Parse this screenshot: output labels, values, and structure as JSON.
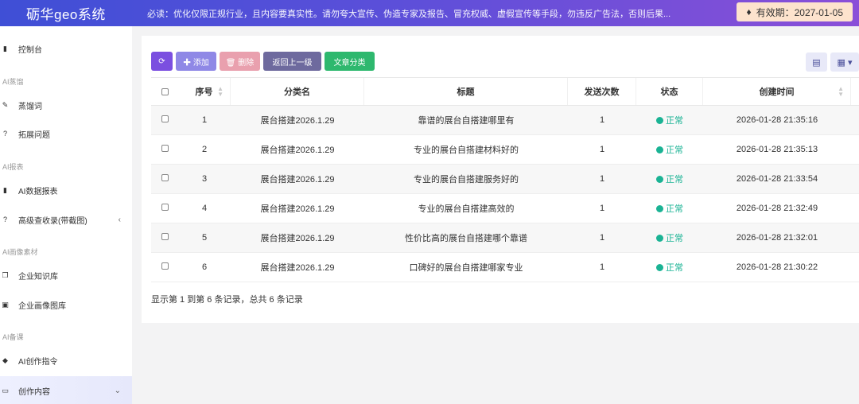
{
  "header": {
    "brand": "砺华geo系统",
    "notice": "必读：优化仅限正规行业，且内容要真实性。请勿夸大宣传、伪造专家及报告、冒充权威、虚假宣传等手段，勿违反广告法，否则后果...",
    "expiry": "有效期：2027-01-05"
  },
  "sidebar": {
    "items": [
      {
        "icon": "bar-chart-icon",
        "glyph": "▮",
        "label": "控制台"
      },
      {
        "group": "AI蒸馏"
      },
      {
        "icon": "pencil-icon",
        "glyph": "✎",
        "label": "蒸馏词"
      },
      {
        "icon": "question-circle-icon",
        "glyph": "?",
        "label": "拓展问题"
      },
      {
        "group": "AI报表"
      },
      {
        "icon": "bar-chart-icon",
        "glyph": "▮",
        "label": "AI数据报表"
      },
      {
        "icon": "question-circle-icon",
        "glyph": "?",
        "label": "高级查收录(带截图)"
      },
      {
        "group": "AI画像素材"
      },
      {
        "icon": "copy-icon",
        "glyph": "❐",
        "label": "企业知识库"
      },
      {
        "icon": "image-icon",
        "glyph": "▣",
        "label": "企业画像图库"
      },
      {
        "group": "AI备课"
      },
      {
        "icon": "tag-icon",
        "glyph": "◆",
        "label": "AI创作指令"
      },
      {
        "icon": "folder-open-icon",
        "glyph": "▭",
        "label": "创作内容"
      }
    ]
  },
  "toolbar": {
    "refresh_glyph": "⟳",
    "add_label": "✚ 添加",
    "delete_label": "🗑 删除",
    "back_label": "返回上一级",
    "category_label": "文章分类"
  },
  "view": {
    "list_glyph": "▤",
    "grid_glyph": "▦ ▾"
  },
  "table": {
    "columns": [
      "序号",
      "分类名",
      "标题",
      "发送次数",
      "状态",
      "创建时间"
    ],
    "rows": [
      {
        "idx": "1",
        "cat": "展台搭建2026.1.29",
        "title": "靠谱的展台自搭建哪里有",
        "count": "1",
        "status": "正常",
        "time": "2026-01-28 21:35:16"
      },
      {
        "idx": "2",
        "cat": "展台搭建2026.1.29",
        "title": "专业的展台自搭建材料好的",
        "count": "1",
        "status": "正常",
        "time": "2026-01-28 21:35:13"
      },
      {
        "idx": "3",
        "cat": "展台搭建2026.1.29",
        "title": "专业的展台自搭建服务好的",
        "count": "1",
        "status": "正常",
        "time": "2026-01-28 21:33:54"
      },
      {
        "idx": "4",
        "cat": "展台搭建2026.1.29",
        "title": "专业的展台自搭建高效的",
        "count": "1",
        "status": "正常",
        "time": "2026-01-28 21:32:49"
      },
      {
        "idx": "5",
        "cat": "展台搭建2026.1.29",
        "title": "性价比高的展台自搭建哪个靠谱",
        "count": "1",
        "status": "正常",
        "time": "2026-01-28 21:32:01"
      },
      {
        "idx": "6",
        "cat": "展台搭建2026.1.29",
        "title": "口碑好的展台自搭建哪家专业",
        "count": "1",
        "status": "正常",
        "time": "2026-01-28 21:30:22"
      }
    ]
  },
  "footer": {
    "summary": "显示第 1 到第 6 条记录，总共 6 条记录"
  },
  "colors": {
    "accent": "#5b4fd9",
    "status_ok": "#1ab394"
  }
}
